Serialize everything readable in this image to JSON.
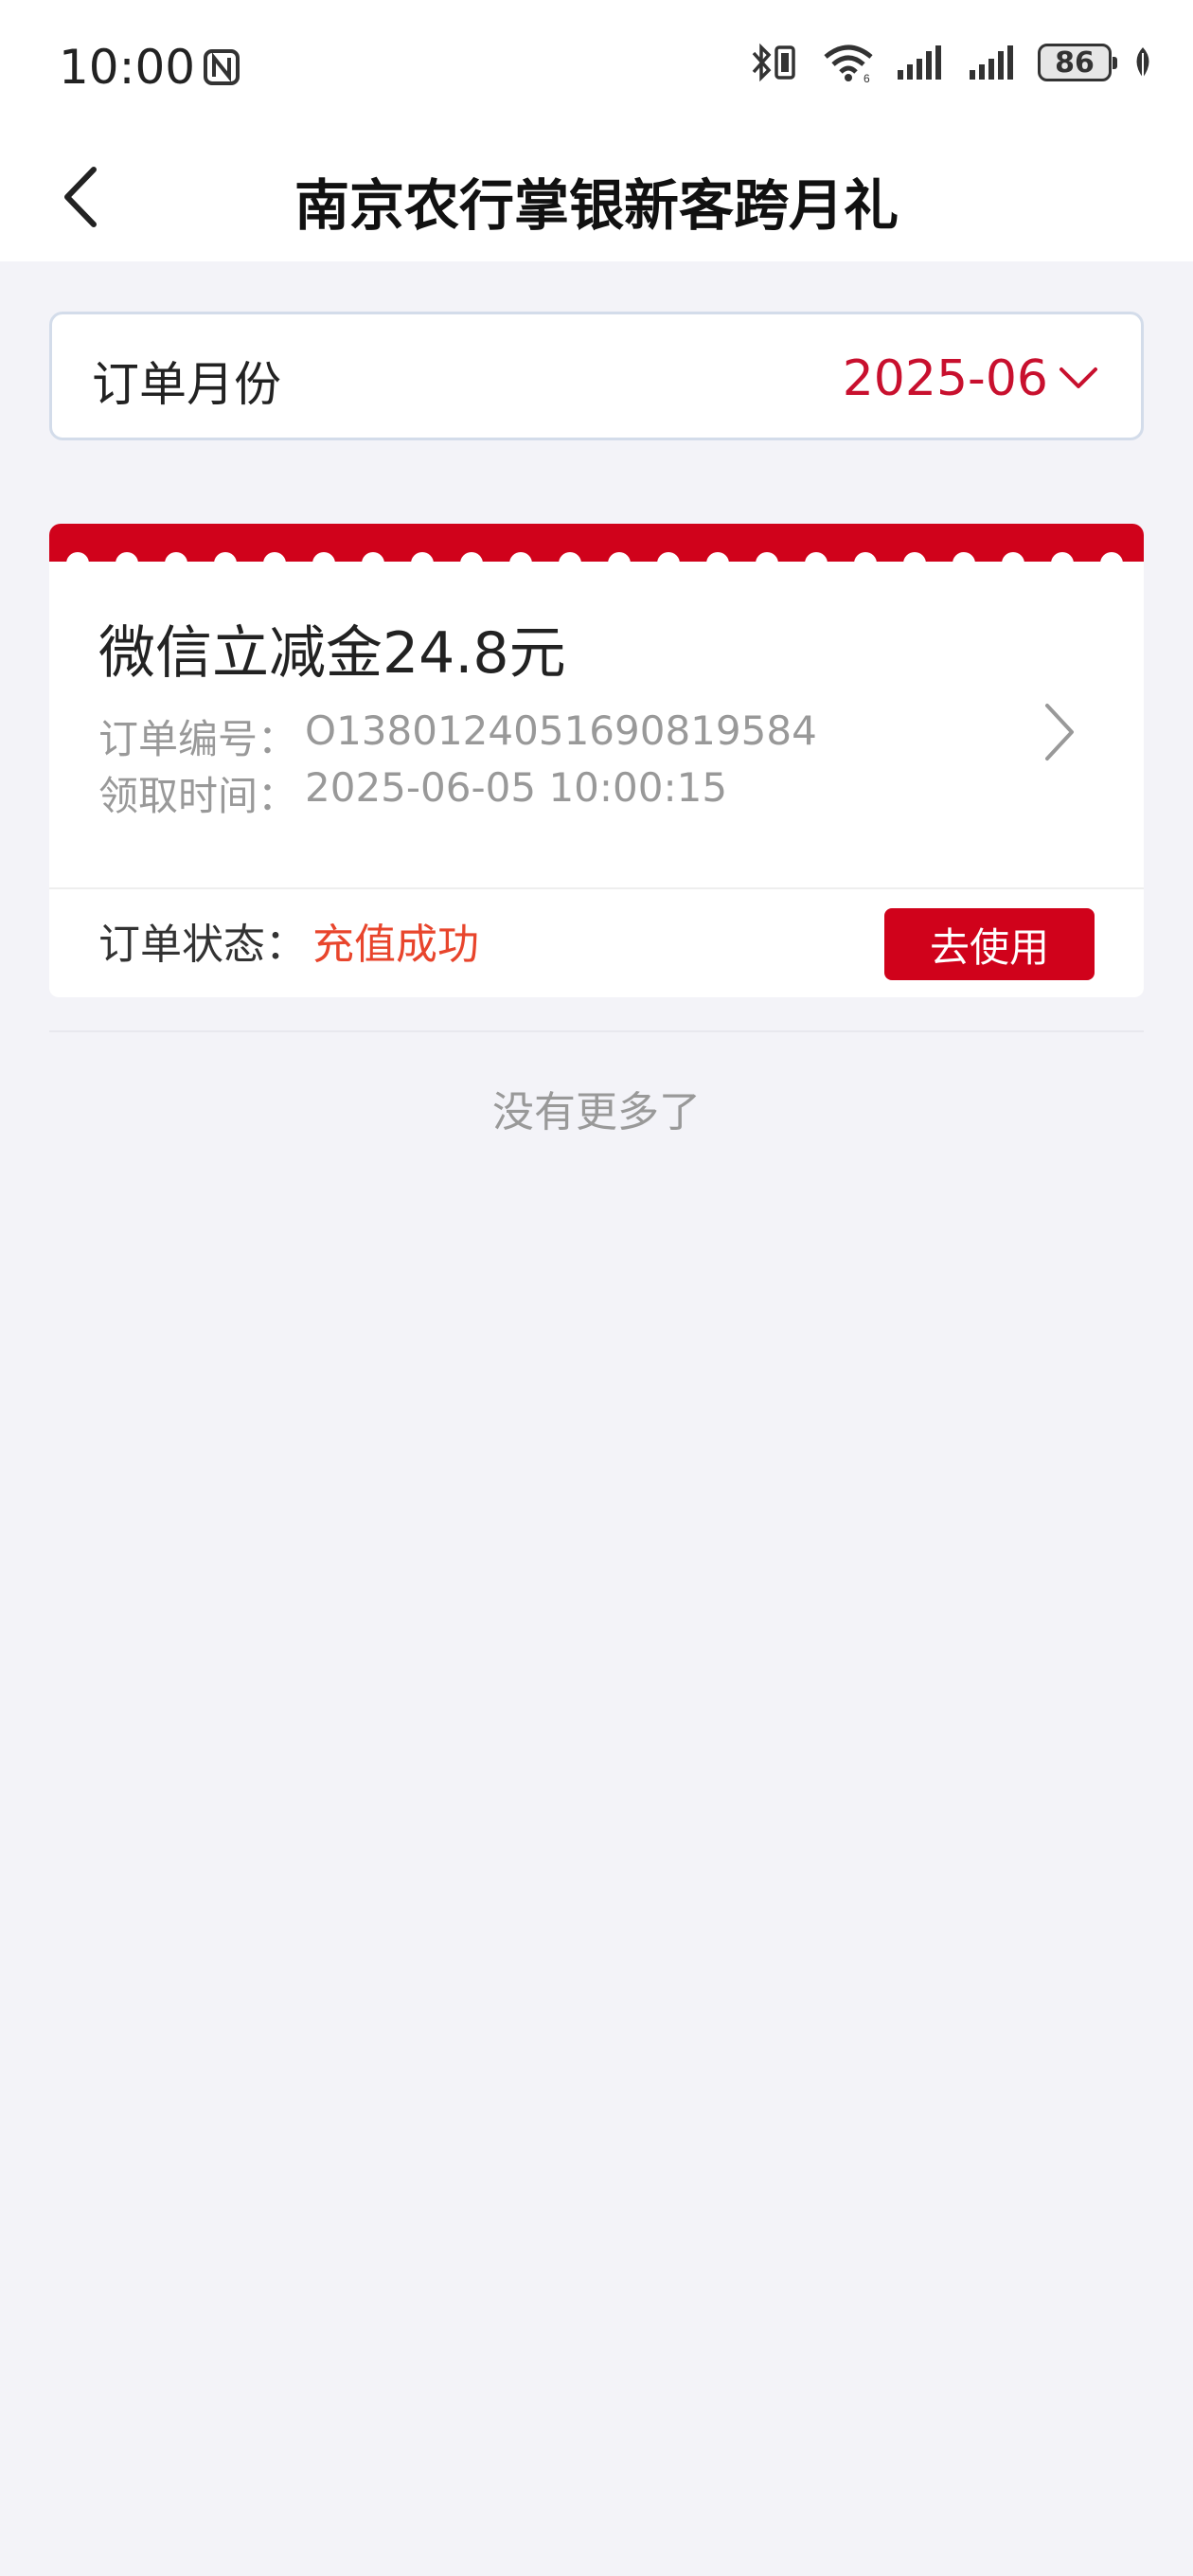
{
  "status_bar": {
    "time": "10:00",
    "battery": "86",
    "icons": [
      "nfc-icon",
      "bluetooth-vibrate-icon",
      "wifi-icon",
      "signal-icon",
      "signal-icon",
      "battery-icon",
      "leaf-icon"
    ]
  },
  "header": {
    "title": "南京农行掌银新客跨月礼",
    "back_icon": "chevron-left-icon"
  },
  "month_filter": {
    "label": "订单月份",
    "value": "2025-06",
    "icon": "chevron-down-icon",
    "accent_color": "#c8102e"
  },
  "orders": [
    {
      "title": "微信立减金24.8元",
      "order_no_label": "订单编号：",
      "order_no": "O1380124051690819584",
      "time_label": "领取时间：",
      "time": "2025-06-05 10:00:15",
      "status_label": "订单状态：",
      "status": "充值成功",
      "status_color": "#e8452c",
      "action_label": "去使用",
      "action_color": "#d0021b"
    }
  ],
  "list_footer": "没有更多了"
}
